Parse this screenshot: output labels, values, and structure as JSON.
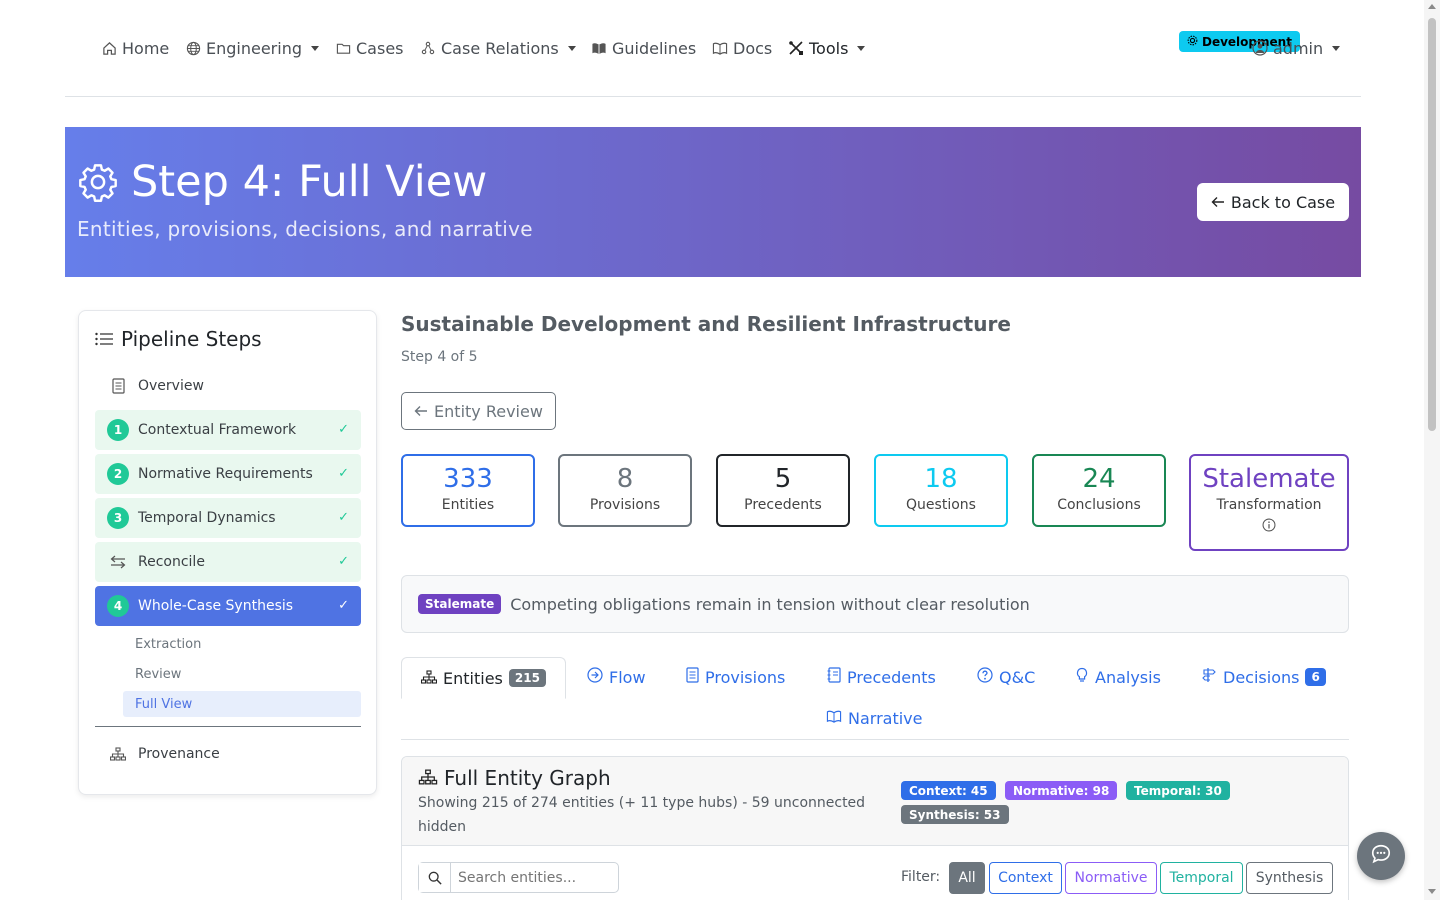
{
  "nav": {
    "items": [
      {
        "label": "Home",
        "icon": "house-icon"
      },
      {
        "label": "Engineering",
        "icon": "globe-icon",
        "dropdown": true
      },
      {
        "label": "Cases",
        "icon": "folder-icon"
      },
      {
        "label": "Case Relations",
        "icon": "diagram-icon",
        "dropdown": true
      },
      {
        "label": "Guidelines",
        "icon": "book-icon"
      },
      {
        "label": "Docs",
        "icon": "book-open-icon"
      },
      {
        "label": "Tools",
        "icon": "tools-icon",
        "dropdown": true
      }
    ],
    "env_badge": "Development",
    "user": "admin"
  },
  "hero": {
    "title": "Step 4: Full View",
    "subtitle": "Entities, provisions, decisions, and narrative",
    "back_label": "Back to Case"
  },
  "sidebar": {
    "title": "Pipeline Steps",
    "overview": "Overview",
    "steps": [
      {
        "num": "1",
        "label": "Contextual Framework",
        "done": true
      },
      {
        "num": "2",
        "label": "Normative Requirements",
        "done": true
      },
      {
        "num": "3",
        "label": "Temporal Dynamics",
        "done": true
      },
      {
        "label": "Reconcile",
        "done": true
      },
      {
        "num": "4",
        "label": "Whole-Case Synthesis",
        "done": true,
        "active": true
      }
    ],
    "substeps": [
      "Extraction",
      "Review",
      "Full View"
    ],
    "current_substep": "Full View",
    "provenance": "Provenance"
  },
  "main": {
    "case_title": "Sustainable Development and Resilient Infrastructure",
    "step_of": "Step 4 of 5",
    "entity_review_label": "Entity Review",
    "stats": [
      {
        "value": "333",
        "label": "Entities",
        "color": "#2f6ee8"
      },
      {
        "value": "8",
        "label": "Provisions",
        "color": "#6c757d"
      },
      {
        "value": "5",
        "label": "Precedents",
        "color": "#212529"
      },
      {
        "value": "18",
        "label": "Questions",
        "color": "#0dcaf0"
      },
      {
        "value": "24",
        "label": "Conclusions",
        "color": "#198754"
      },
      {
        "value": "Stalemate",
        "label": "Transformation",
        "color": "#6f42c1"
      }
    ],
    "alert": {
      "badge": "Stalemate",
      "text": "Competing obligations remain in tension without clear resolution"
    },
    "tabs": [
      {
        "label": "Entities",
        "badge": "215",
        "active": true
      },
      {
        "label": "Flow"
      },
      {
        "label": "Provisions"
      },
      {
        "label": "Precedents"
      },
      {
        "label": "Q&C"
      },
      {
        "label": "Analysis"
      },
      {
        "label": "Decisions",
        "badge": "6"
      },
      {
        "label": "Narrative"
      }
    ],
    "graph": {
      "title": "Full Entity Graph",
      "desc": "Showing 215 of 274 entities (+ 11 type hubs) - 59 unconnected hidden",
      "badges": [
        {
          "label": "Context: 45",
          "color": "#2f6ee8"
        },
        {
          "label": "Normative: 98",
          "color": "#8b5cf6"
        },
        {
          "label": "Temporal: 30",
          "color": "#20b2a0"
        },
        {
          "label": "Synthesis: 53",
          "color": "#6c757d"
        }
      ],
      "search_placeholder": "Search entities...",
      "filter_label": "Filter:",
      "filters": [
        {
          "label": "All",
          "active": true
        },
        {
          "label": "Context"
        },
        {
          "label": "Normative"
        },
        {
          "label": "Temporal"
        },
        {
          "label": "Synthesis"
        }
      ]
    }
  }
}
